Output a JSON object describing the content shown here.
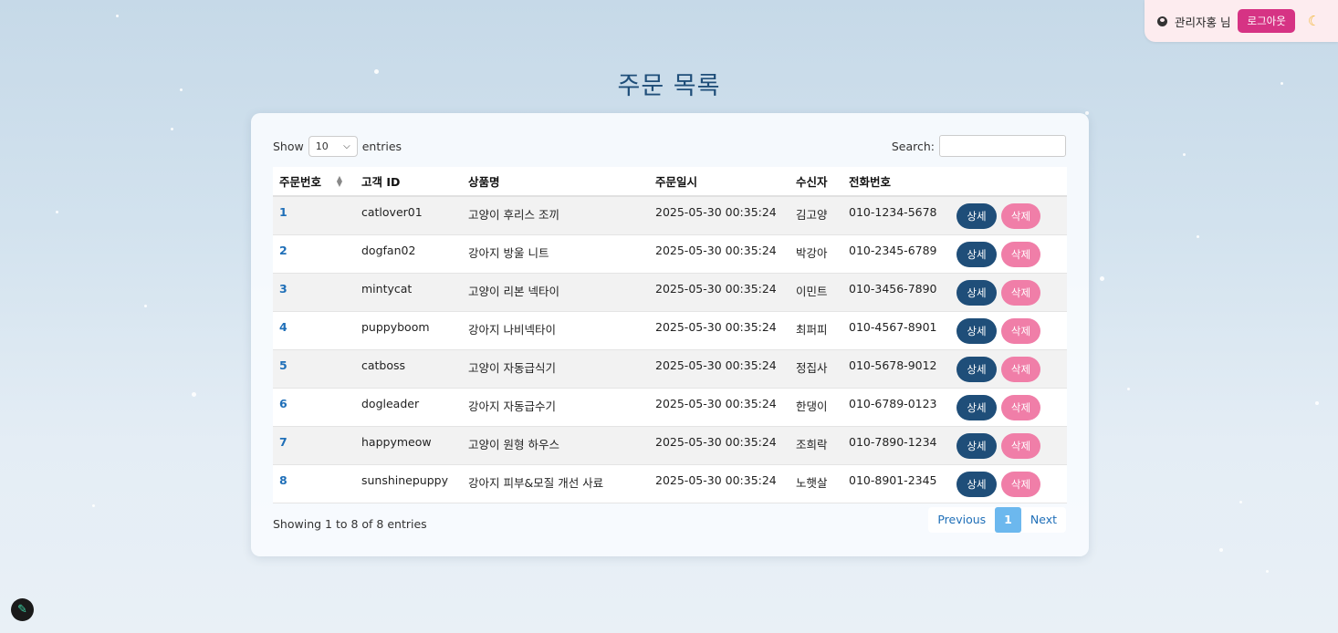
{
  "user": {
    "name": "관리자홍 님",
    "logout_label": "로그아웃"
  },
  "page": {
    "title": "주문 목록"
  },
  "controls": {
    "show_label": "Show",
    "length_value": "10",
    "entries_label": "entries",
    "search_label": "Search:",
    "search_value": ""
  },
  "table": {
    "columns": [
      "주문번호",
      "고객 ID",
      "상품명",
      "주문일시",
      "수신자",
      "전화번호",
      ""
    ],
    "rows": [
      {
        "id": "1",
        "customer": "catlover01",
        "product": "고양이 후리스 조끼",
        "date": "2025-05-30 00:35:24",
        "receiver": "김고양",
        "phone": "010-1234-5678",
        "detail": "상세",
        "delete": "삭제"
      },
      {
        "id": "2",
        "customer": "dogfan02",
        "product": "강아지 방울 니트",
        "date": "2025-05-30 00:35:24",
        "receiver": "박강아",
        "phone": "010-2345-6789",
        "detail": "상세",
        "delete": "삭제"
      },
      {
        "id": "3",
        "customer": "mintycat",
        "product": "고양이 리본 넥타이",
        "date": "2025-05-30 00:35:24",
        "receiver": "이민트",
        "phone": "010-3456-7890",
        "detail": "상세",
        "delete": "삭제"
      },
      {
        "id": "4",
        "customer": "puppyboom",
        "product": "강아지 나비넥타이",
        "date": "2025-05-30 00:35:24",
        "receiver": "최퍼피",
        "phone": "010-4567-8901",
        "detail": "상세",
        "delete": "삭제"
      },
      {
        "id": "5",
        "customer": "catboss",
        "product": "고양이 자동급식기",
        "date": "2025-05-30 00:35:24",
        "receiver": "정집사",
        "phone": "010-5678-9012",
        "detail": "상세",
        "delete": "삭제"
      },
      {
        "id": "6",
        "customer": "dogleader",
        "product": "강아지 자동급수기",
        "date": "2025-05-30 00:35:24",
        "receiver": "한댕이",
        "phone": "010-6789-0123",
        "detail": "상세",
        "delete": "삭제"
      },
      {
        "id": "7",
        "customer": "happymeow",
        "product": "고양이 원형 하우스",
        "date": "2025-05-30 00:35:24",
        "receiver": "조희락",
        "phone": "010-7890-1234",
        "detail": "상세",
        "delete": "삭제"
      },
      {
        "id": "8",
        "customer": "sunshinepuppy",
        "product": "강아지 피부&모질 개선 사료",
        "date": "2025-05-30 00:35:24",
        "receiver": "노햇살",
        "phone": "010-8901-2345",
        "detail": "상세",
        "delete": "삭제"
      }
    ]
  },
  "footer": {
    "info": "Showing 1 to 8 of 8 entries",
    "previous_label": "Previous",
    "current_page": "1",
    "next_label": "Next"
  },
  "colors": {
    "accent": "#1f4e79",
    "delete": "#f07ea8",
    "logout": "#d63384",
    "active_page": "#6cb8ee"
  },
  "icons": [
    "user-circle-icon",
    "moon-icon",
    "chevron-down-icon",
    "sort-icon",
    "pencil-icon"
  ]
}
